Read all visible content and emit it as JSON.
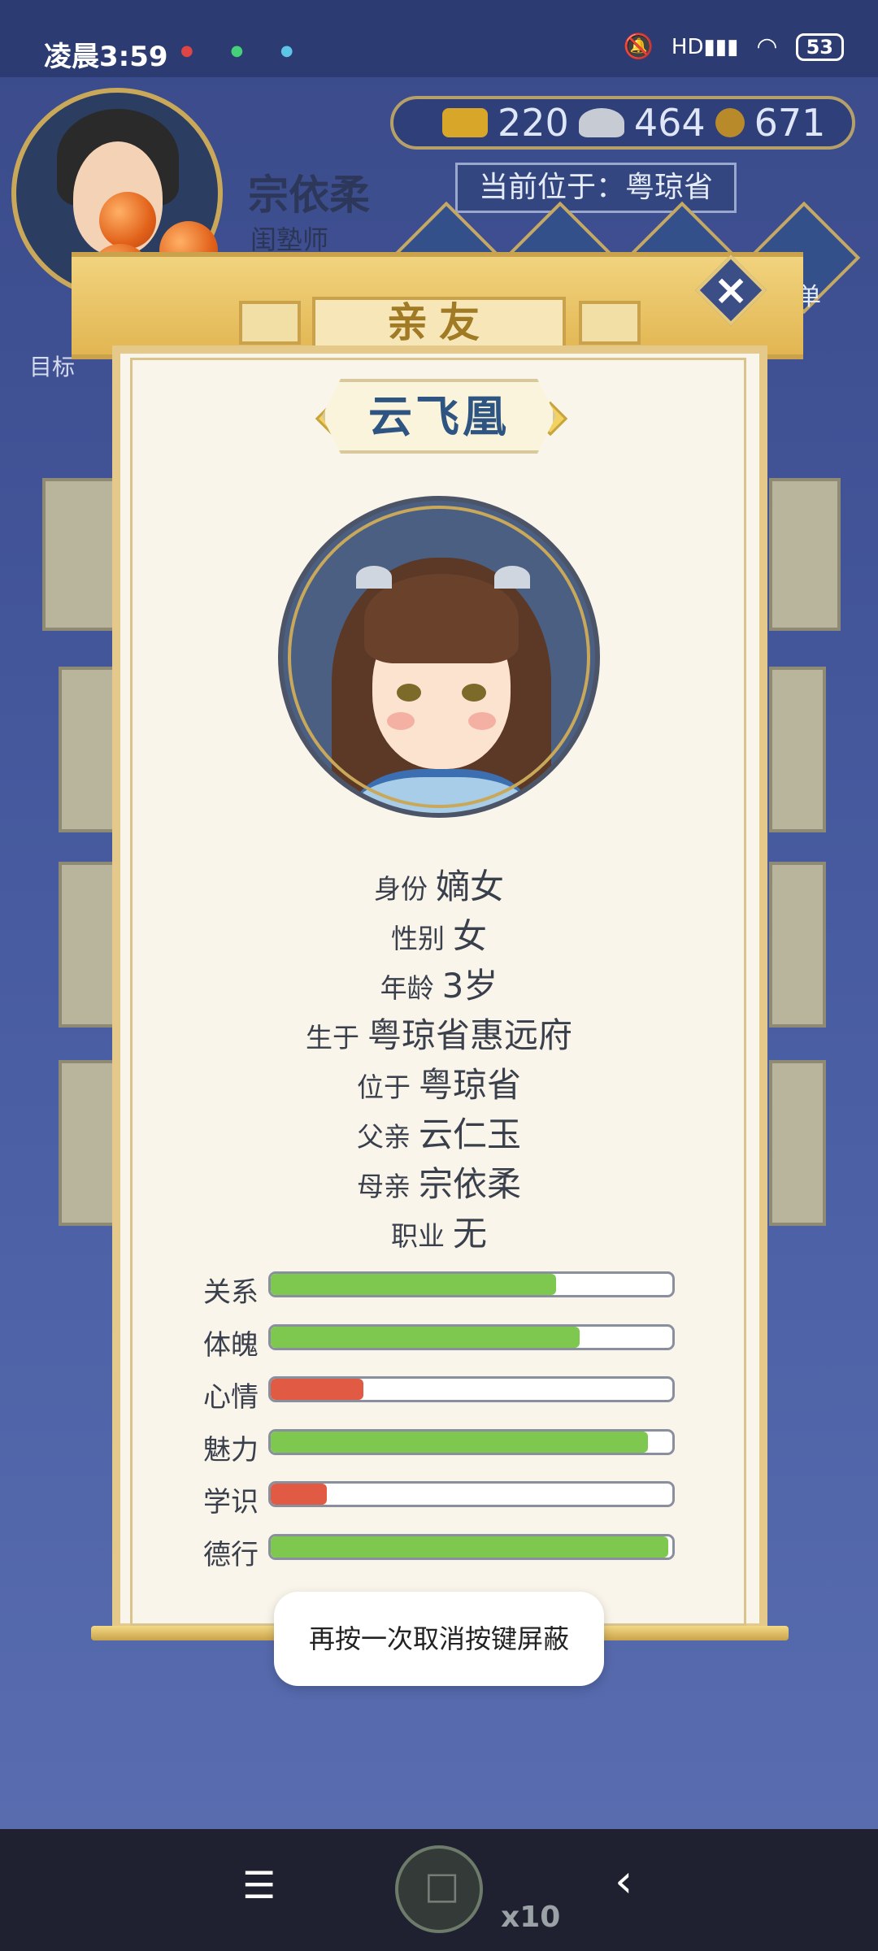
{
  "status_bar": {
    "time": "凌晨3:59",
    "battery": "53",
    "icons": [
      "alarm-off-icon",
      "hd-signal-icon",
      "wifi-icon"
    ]
  },
  "hud": {
    "player_name": "宗依柔",
    "player_job": "闺塾师",
    "goal_label": "目标",
    "currency": {
      "gold": "220",
      "silver": "464",
      "coin": "671"
    },
    "location": "当前位于：粤琼省",
    "menu_label": "菜单"
  },
  "dialog": {
    "tab_title": "亲友",
    "character_name": "云飞凰",
    "info": [
      {
        "key": "身份",
        "value": "嫡女"
      },
      {
        "key": "性别",
        "value": "女"
      },
      {
        "key": "年龄",
        "value": "3岁"
      },
      {
        "key": "生于",
        "value": "粤琼省惠远府"
      },
      {
        "key": "位于",
        "value": "粤琼省"
      },
      {
        "key": "父亲",
        "value": "云仁玉"
      },
      {
        "key": "母亲",
        "value": "宗依柔"
      },
      {
        "key": "职业",
        "value": "无"
      }
    ],
    "stats": [
      {
        "label": "关系",
        "value": 0.71,
        "color": "#7ec850"
      },
      {
        "label": "体魄",
        "value": 0.77,
        "color": "#7ec850"
      },
      {
        "label": "心情",
        "value": 0.23,
        "color": "#e05a44"
      },
      {
        "label": "魅力",
        "value": 0.94,
        "color": "#7ec850"
      },
      {
        "label": "学识",
        "value": 0.14,
        "color": "#e05a44"
      },
      {
        "label": "德行",
        "value": 0.99,
        "color": "#7ec850"
      }
    ]
  },
  "toast": "再按一次取消按键屏蔽",
  "floating_badge": "x10",
  "nav": {
    "menu_icon": "☰",
    "home_icon": "□",
    "back_icon": "‹"
  }
}
